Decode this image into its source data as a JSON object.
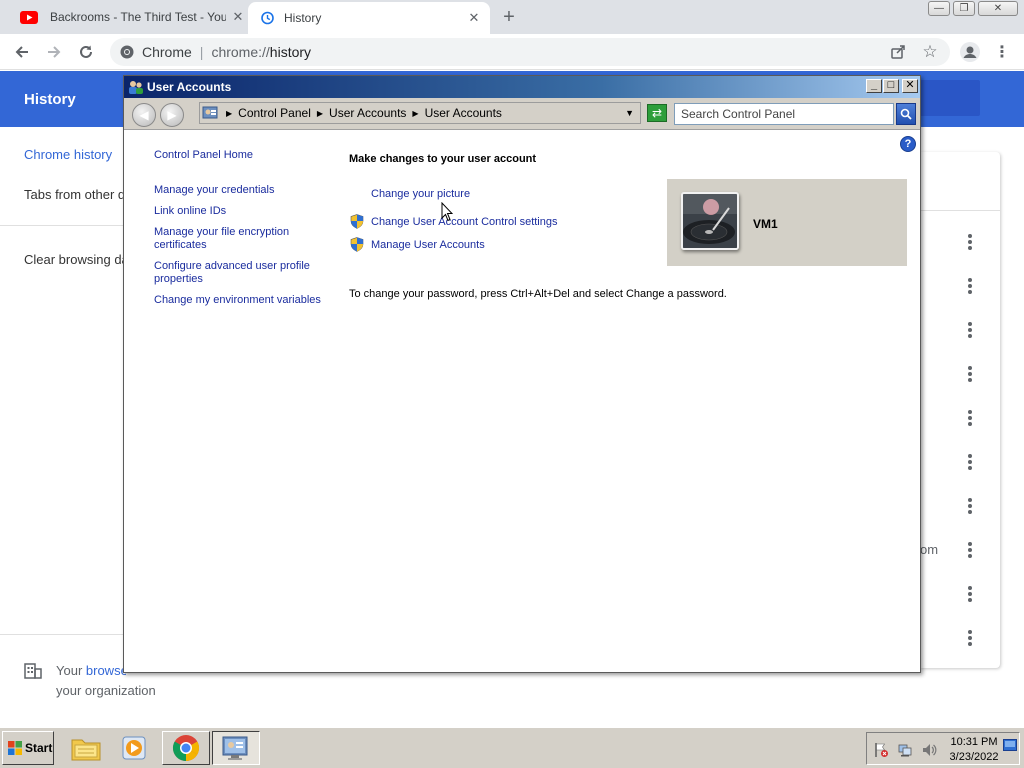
{
  "browser": {
    "tabs": [
      {
        "title": "Backrooms - The Third Test - YouTube",
        "icon": "youtube-icon",
        "active": false
      },
      {
        "title": "History",
        "icon": "history-icon",
        "active": true
      }
    ],
    "omnibox": {
      "site_label": "Chrome",
      "url_prefix": "chrome://",
      "url_path": "history"
    }
  },
  "history_page": {
    "title": "History",
    "sidebar": {
      "items": [
        "Chrome history",
        "Tabs from other devices",
        "Clear browsing data"
      ]
    },
    "managed_note": {
      "prefix": "Your ",
      "link": "browser is managed",
      "line2": "your organization"
    },
    "card_partial_text": "om"
  },
  "user_accounts": {
    "window_title": "User Accounts",
    "breadcrumbs": [
      "Control Panel",
      "User Accounts",
      "User Accounts"
    ],
    "search_placeholder": "Search Control Panel",
    "tasks": [
      "Control Panel Home",
      "Manage your credentials",
      "Link online IDs",
      "Manage your file encryption certificates",
      "Configure advanced user profile properties",
      "Change my environment variables"
    ],
    "heading": "Make changes to your user account",
    "actions": [
      "Change your picture",
      "Change User Account Control settings",
      "Manage User Accounts"
    ],
    "password_note": "To change your password, press Ctrl+Alt+Del and select Change a password.",
    "user_name": "VM1"
  },
  "taskbar": {
    "start_label": "Start",
    "apps": [
      "explorer-icon",
      "media-player-icon",
      "chrome-icon",
      "control-panel-icon"
    ],
    "time": "10:31 PM",
    "date": "3/23/2022"
  }
}
